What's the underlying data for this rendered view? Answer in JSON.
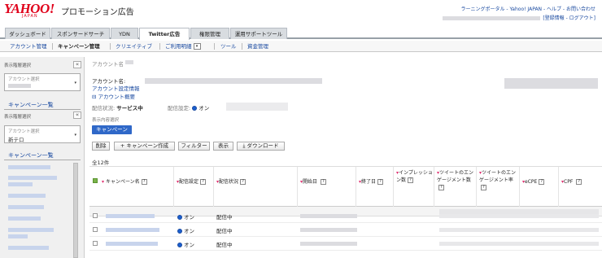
{
  "brand": {
    "logo_text": "YAHOO!",
    "logo_sub": "JAPAN",
    "app_name": "プロモーション広告"
  },
  "header": {
    "top_links": "ラーニングポータル - Yahoo! JAPAN - ヘルプ - お問い合わせ",
    "user_links": "[登録情報 - ログアウト]"
  },
  "main_tabs": [
    "ダッシュボード",
    "スポンサードサーチ",
    "YDN",
    "Twitter広告",
    "権限管理",
    "運用サポートツール"
  ],
  "sub_nav": {
    "items": [
      "アカウント管理",
      "キャンペーン管理",
      "クリエイティブ",
      "ご利用明細",
      "ツール",
      "資金管理"
    ],
    "dropdown_icon": "▾"
  },
  "sidebar": {
    "collapse_icon": "«",
    "section1_title": "表示階層選択",
    "account_select_label": "アカウント選択",
    "campaign_list_title": "キャンペーン一覧",
    "section2_title": "表示階層選択",
    "account_select_label2": "アカウント選択",
    "account_select_value2": "新テロ",
    "campaign_list_title2": "キャンペーン一覧",
    "select_arrow": "▾"
  },
  "main": {
    "account_name_label": "アカウント名",
    "account_heading": "アカウント名:",
    "account_settings_link": "アカウント設定情報",
    "account_overview_link": "⊟ アカウント概要",
    "delivery_status_label": "配信状況:",
    "delivery_status_value": "サービス中",
    "delivery_setting_label": "配信設定:",
    "delivery_setting_value": "オン",
    "display_select_label": "表示内容選択",
    "campaign_button": "キャンペーン",
    "toolbar": [
      "削除",
      "+ キャンペーン作成",
      "フィルター",
      "表示",
      "⤓ ダウンロード"
    ],
    "count_text": "全12件"
  },
  "table": {
    "columns": [
      {
        "label": "キャンペーン名",
        "sort": "▾"
      },
      {
        "label": "配信設定",
        "sort": "▾"
      },
      {
        "label": "配信状況",
        "sort": "▾"
      },
      {
        "label": "開始日",
        "sort": "▾"
      },
      {
        "label": "終了日",
        "sort": "▾"
      },
      {
        "label": "インプレッション数",
        "sort": "▾"
      },
      {
        "label": "ツイートのエンゲージメント数",
        "sort": "▾"
      },
      {
        "label": "ツイートのエンゲージメント率",
        "sort": "▾"
      },
      {
        "label": "eCPE",
        "sort": "▾"
      },
      {
        "label": "CPF",
        "sort": "▾"
      }
    ],
    "help_icon": "?",
    "rows": [
      {
        "setting": "オン",
        "status": "配信中"
      },
      {
        "setting": "オン",
        "status": "配信中"
      },
      {
        "setting": "オン",
        "status": "配信中"
      }
    ]
  },
  "colors": {
    "accent_blue": "#2f68c8",
    "logo_red": "#e0001a",
    "link": "#1a4aa0"
  }
}
